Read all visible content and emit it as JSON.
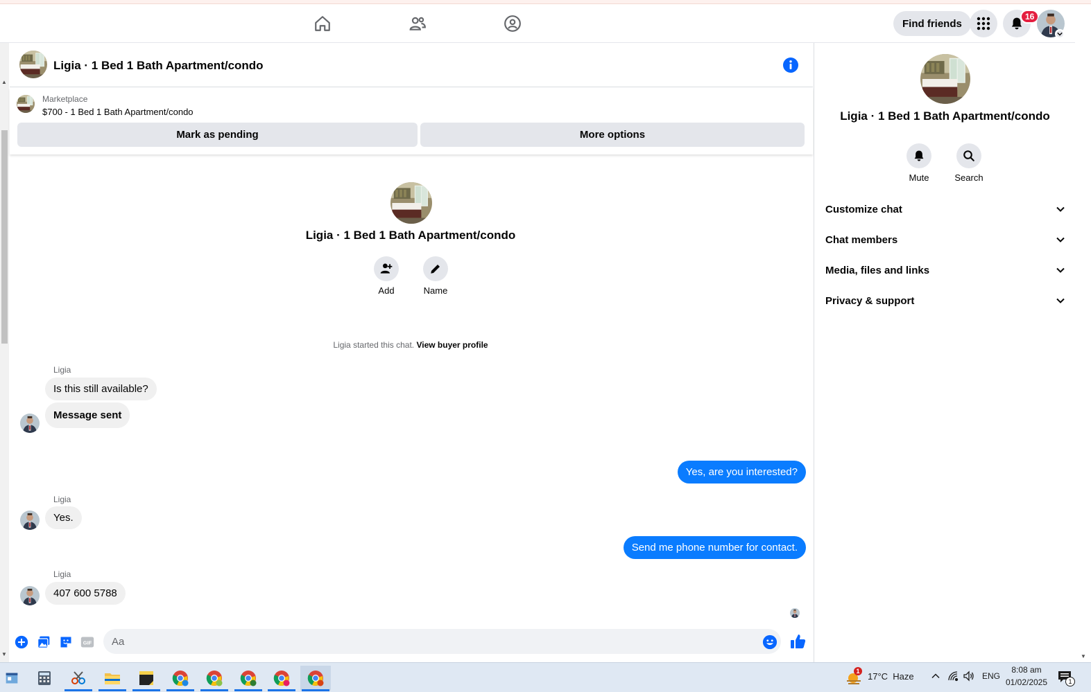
{
  "header": {
    "find_friends": "Find friends",
    "notification_count": "16",
    "nav_icons": [
      "home-icon",
      "friends-icon",
      "groups-icon"
    ]
  },
  "chat": {
    "title": "Ligia · 1 Bed 1 Bath Apartment/condo",
    "marketplace_label": "Marketplace",
    "listing": "$700 - 1 Bed 1 Bath Apartment/condo",
    "mark_pending": "Mark as pending",
    "more_options": "More options",
    "intro_title": "Ligia · 1 Bed 1 Bath Apartment/condo",
    "add_label": "Add",
    "name_label": "Name",
    "started_text": "Ligia started this chat.",
    "view_buyer": "View buyer profile",
    "messages": [
      {
        "sender": "Ligia",
        "text": "Is this still available?"
      },
      {
        "text": "Message sent"
      },
      {
        "text": "Yes, are you interested?"
      },
      {
        "sender": "Ligia",
        "text": "Yes."
      },
      {
        "text": "Send me phone number for contact."
      },
      {
        "sender": "Ligia",
        "text": "407 600 5788"
      }
    ],
    "composer_placeholder": "Aa"
  },
  "panel": {
    "title": "Ligia · 1 Bed 1 Bath Apartment/condo",
    "mute": "Mute",
    "search": "Search",
    "sections": [
      "Customize chat",
      "Chat members",
      "Media, files and links",
      "Privacy & support"
    ]
  },
  "taskbar": {
    "weather": "17°C  Haze",
    "weather_badge": "1",
    "lang": "ENG",
    "time": "8:08 am",
    "date": "01/02/2025",
    "notif_count": "1"
  },
  "colors": {
    "accent": "#0a7cff",
    "icon_blue": "#0866ff",
    "badge_red": "#e41e3f",
    "neutral_btn": "#e4e6eb"
  }
}
